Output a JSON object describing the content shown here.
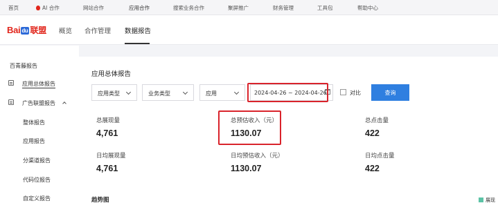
{
  "topnav": {
    "home": "首页",
    "ai": "AI 合作",
    "site": "网站合作",
    "app": "应用合作",
    "search": "搜索业务合作",
    "screen": "聚屏推广",
    "finance": "财务管理",
    "tools": "工具包",
    "help": "帮助中心"
  },
  "header": {
    "logo_bai": "Bai",
    "logo_du": "du",
    "logo_lm": "联盟",
    "nav": [
      "概览",
      "合作管理",
      "数据报告"
    ]
  },
  "sidebar": {
    "items": [
      {
        "label": "百青藤报告"
      },
      {
        "label": "应用总体报告"
      },
      {
        "label": "广告联盟报告"
      },
      {
        "label": "整体报告"
      },
      {
        "label": "应用报告"
      },
      {
        "label": "分渠道报告"
      },
      {
        "label": "代码位报告"
      },
      {
        "label": "自定义报告"
      }
    ]
  },
  "main": {
    "title": "应用总体报告",
    "filters": {
      "app_type": "应用类型",
      "biz_type": "业务类型",
      "app": "应用",
      "date_range": "2024-04-26 ~ 2024-04-26",
      "compare_label": "对比",
      "query_label": "查询"
    },
    "metrics": [
      {
        "label": "总展现量",
        "value": "4,761"
      },
      {
        "label": "总预估收入（元）",
        "value": "1130.07"
      },
      {
        "label": "总点击量",
        "value": "422"
      },
      {
        "label": "日均展现量",
        "value": "4,761"
      },
      {
        "label": "日均预估收入（元）",
        "value": "1130.07"
      },
      {
        "label": "日均点击量",
        "value": "422"
      }
    ],
    "trend_title": "趋势图",
    "legend_label": "展现",
    "legend_color": "#5cc3a6"
  },
  "accent_color": "#2f7fe0",
  "highlight_color": "#d9232b"
}
